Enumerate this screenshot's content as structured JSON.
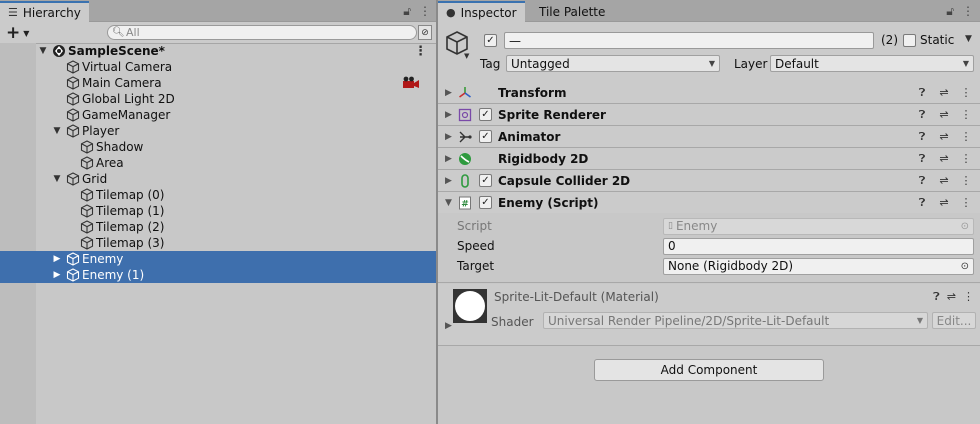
{
  "hierarchy": {
    "tab_label": "Hierarchy",
    "search_placeholder": "All",
    "add_symbol": "+",
    "items": [
      {
        "label": "SampleScene*",
        "depth": 0,
        "arrow": "▼",
        "icon": "unity-scene-icon",
        "scene": true
      },
      {
        "label": "Virtual Camera",
        "depth": 1,
        "arrow": "",
        "icon": "gameobject-cube-icon"
      },
      {
        "label": "Main Camera",
        "depth": 1,
        "arrow": "",
        "icon": "gameobject-cube-icon"
      },
      {
        "label": "Global Light 2D",
        "depth": 1,
        "arrow": "",
        "icon": "gameobject-cube-icon"
      },
      {
        "label": "GameManager",
        "depth": 1,
        "arrow": "",
        "icon": "gameobject-cube-icon"
      },
      {
        "label": "Player",
        "depth": 1,
        "arrow": "▼",
        "icon": "gameobject-cube-icon"
      },
      {
        "label": "Shadow",
        "depth": 2,
        "arrow": "",
        "icon": "gameobject-cube-icon"
      },
      {
        "label": "Area",
        "depth": 2,
        "arrow": "",
        "icon": "gameobject-cube-icon"
      },
      {
        "label": "Grid",
        "depth": 1,
        "arrow": "▼",
        "icon": "gameobject-cube-icon"
      },
      {
        "label": "Tilemap (0)",
        "depth": 2,
        "arrow": "",
        "icon": "gameobject-cube-icon"
      },
      {
        "label": "Tilemap (1)",
        "depth": 2,
        "arrow": "",
        "icon": "gameobject-cube-icon"
      },
      {
        "label": "Tilemap (2)",
        "depth": 2,
        "arrow": "",
        "icon": "gameobject-cube-icon"
      },
      {
        "label": "Tilemap (3)",
        "depth": 2,
        "arrow": "",
        "icon": "gameobject-cube-icon"
      },
      {
        "label": "Enemy",
        "depth": 1,
        "arrow": "▶",
        "icon": "gameobject-cube-icon",
        "selected": true
      },
      {
        "label": "Enemy (1)",
        "depth": 1,
        "arrow": "▶",
        "icon": "gameobject-cube-icon",
        "selected": true
      }
    ]
  },
  "inspector": {
    "tabs": [
      "Inspector",
      "Tile Palette"
    ],
    "object_name": "—",
    "object_count": "(2)",
    "static_label": "Static",
    "tag_label": "Tag",
    "tag_value": "Untagged",
    "layer_label": "Layer",
    "layer_value": "Default",
    "components": [
      {
        "name": "Transform",
        "icon": "transform-icon",
        "checkbox": false
      },
      {
        "name": "Sprite Renderer",
        "icon": "sprite-renderer-icon",
        "checkbox": true
      },
      {
        "name": "Animator",
        "icon": "animator-icon",
        "checkbox": true
      },
      {
        "name": "Rigidbody 2D",
        "icon": "rigidbody2d-icon",
        "checkbox": false
      },
      {
        "name": "Capsule Collider 2D",
        "icon": "capsule-collider-icon",
        "checkbox": true
      },
      {
        "name": "Enemy (Script)",
        "icon": "script-icon",
        "checkbox": true,
        "expanded": true
      }
    ],
    "script_props": {
      "script_label": "Script",
      "script_value": "Enemy",
      "speed_label": "Speed",
      "speed_value": "0",
      "target_label": "Target",
      "target_value": "None (Rigidbody 2D)"
    },
    "material": {
      "name": "Sprite-Lit-Default (Material)",
      "shader_label": "Shader",
      "shader_value": "Universal Render Pipeline/2D/Sprite-Lit-Default",
      "edit_label": "Edit..."
    },
    "add_component_label": "Add Component"
  },
  "colors": {
    "selection": "#3e6fad",
    "panel": "#c8c8c8",
    "tab_bar": "#a5a5a5",
    "tab_accent": "#3a72b0"
  }
}
